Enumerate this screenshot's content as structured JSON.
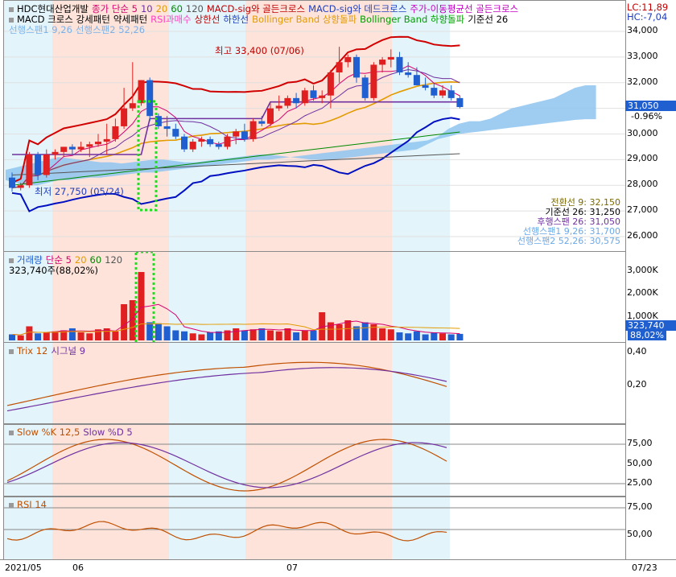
{
  "price_legend_line1": [
    {
      "text": "HDC현대산업개발",
      "color": "#000000"
    },
    {
      "text": "종가 단순 5",
      "color": "#d6006e"
    },
    {
      "text": "10",
      "color": "#7030a0"
    },
    {
      "text": "20",
      "color": "#e39b00"
    },
    {
      "text": "60",
      "color": "#008a00"
    },
    {
      "text": "120",
      "color": "#555555"
    },
    {
      "text": "MACD-sig와 골든크로스",
      "color": "#c00000"
    },
    {
      "text": "MACD-sig와 데드크로스",
      "color": "#1f3fbf"
    },
    {
      "text": "주가-이동평균선 골든크로스",
      "color": "#c000c0"
    }
  ],
  "price_legend_line2": [
    {
      "text": "MACD 크로스 강세패턴",
      "color": "#000000"
    },
    {
      "text": "약세패턴",
      "color": "#000000"
    },
    {
      "text": "RSI과매수",
      "color": "#ff40c0"
    },
    {
      "text": "상한선",
      "color": "#c00000"
    },
    {
      "text": "하한선",
      "color": "#1f3fbf"
    },
    {
      "text": "Bollinger Band 상향돌파",
      "color": "#e39b00"
    },
    {
      "text": "Bollinger Band 하향돌파",
      "color": "#00a000"
    },
    {
      "text": "기준선 26",
      "color": "#000000"
    }
  ],
  "price_legend_line3": [
    {
      "text": "선행스팬1 9,26",
      "color": "#6aa8e8"
    },
    {
      "text": "선행스팬2 52,26",
      "color": "#6aa8e8"
    }
  ],
  "top_right": {
    "lc": "LC:11,89",
    "hc": "HC:-7,04"
  },
  "price_axis": [
    "34,000",
    "33,000",
    "32,000",
    "31,000",
    "30,000",
    "29,000",
    "28,000",
    "27,000",
    "26,000"
  ],
  "current_price": {
    "value": "31,050",
    "change": "-0.96%"
  },
  "annotations": {
    "high": "최고 33,400 (07/06)",
    "low": "최저 27,750 (05/24)"
  },
  "ichimoku_labels": [
    {
      "text": "전환선 9: 32,150",
      "color": "#7a6a00"
    },
    {
      "text": "기준선 26: 31,250",
      "color": "#000000"
    },
    {
      "text": "후행스팬 26: 31,050",
      "color": "#7030a0"
    },
    {
      "text": "선행스팬1 9,26: 31,700",
      "color": "#6aa8e8"
    },
    {
      "text": "선행스팬2 52,26: 30,575",
      "color": "#6aa8e8"
    }
  ],
  "volume": {
    "legend": [
      {
        "text": "거래량",
        "color": "#1f5fd0"
      },
      {
        "text": "단순 5",
        "color": "#d6006e"
      },
      {
        "text": "20",
        "color": "#e39b00"
      },
      {
        "text": "60",
        "color": "#008a00"
      },
      {
        "text": "120",
        "color": "#555555"
      }
    ],
    "value_label": "323,740주(88,02%)",
    "axis": [
      "3,000K",
      "2,000K",
      "1,000K"
    ],
    "current": "323,740",
    "current_pct": "88,02%"
  },
  "trix": {
    "legend": [
      {
        "text": "Trix 12",
        "color": "#c05000"
      },
      {
        "text": "시그널 9",
        "color": "#7030a0"
      }
    ],
    "axis": [
      "0,40",
      "0,20"
    ]
  },
  "slow": {
    "legend": [
      {
        "text": "Slow %K 12,5",
        "color": "#c05000"
      },
      {
        "text": "Slow %D 5",
        "color": "#7030a0"
      }
    ],
    "axis": [
      "75,00",
      "50,00",
      "25,00"
    ]
  },
  "rsi": {
    "legend": [
      {
        "text": "RSI 14",
        "color": "#c05000"
      }
    ],
    "axis": [
      "75,00",
      "50,00"
    ]
  },
  "date_axis": {
    "labels": [
      "2021/05",
      "06",
      "07"
    ],
    "right": "07/23"
  },
  "colors": {
    "up": "#e02020",
    "down": "#1f5fd0",
    "bg_pink": "#fde3da",
    "bg_blue": "#e3f4fb",
    "cloud": "#8ec4f0"
  },
  "chart_data": {
    "type": "candlestick",
    "candles": [
      {
        "o": 28300,
        "h": 28500,
        "l": 27750,
        "c": 27900
      },
      {
        "o": 27900,
        "h": 28100,
        "l": 27800,
        "c": 28000
      },
      {
        "o": 28000,
        "h": 29300,
        "l": 27900,
        "c": 29200
      },
      {
        "o": 29200,
        "h": 29300,
        "l": 28200,
        "c": 28400
      },
      {
        "o": 28400,
        "h": 29400,
        "l": 28300,
        "c": 29200
      },
      {
        "o": 29200,
        "h": 29400,
        "l": 29000,
        "c": 29300
      },
      {
        "o": 29300,
        "h": 29500,
        "l": 29100,
        "c": 29500
      },
      {
        "o": 29500,
        "h": 29600,
        "l": 29200,
        "c": 29400
      },
      {
        "o": 29400,
        "h": 29700,
        "l": 29300,
        "c": 29500
      },
      {
        "o": 29500,
        "h": 29700,
        "l": 29100,
        "c": 29600
      },
      {
        "o": 29600,
        "h": 30000,
        "l": 29500,
        "c": 29700
      },
      {
        "o": 29700,
        "h": 30400,
        "l": 29200,
        "c": 29800
      },
      {
        "o": 29800,
        "h": 30600,
        "l": 29700,
        "c": 30300
      },
      {
        "o": 30300,
        "h": 31800,
        "l": 30200,
        "c": 31000
      },
      {
        "o": 31000,
        "h": 32800,
        "l": 30900,
        "c": 31200
      },
      {
        "o": 31200,
        "h": 32100,
        "l": 31100,
        "c": 32100
      },
      {
        "o": 32100,
        "h": 32200,
        "l": 30500,
        "c": 30700
      },
      {
        "o": 30700,
        "h": 30800,
        "l": 30200,
        "c": 30300
      },
      {
        "o": 30300,
        "h": 30700,
        "l": 29900,
        "c": 30200
      },
      {
        "o": 30200,
        "h": 30400,
        "l": 29800,
        "c": 29900
      },
      {
        "o": 29900,
        "h": 30000,
        "l": 29300,
        "c": 29400
      },
      {
        "o": 29400,
        "h": 29800,
        "l": 29300,
        "c": 29700
      },
      {
        "o": 29700,
        "h": 29900,
        "l": 29500,
        "c": 29800
      },
      {
        "o": 29800,
        "h": 29900,
        "l": 29500,
        "c": 29600
      },
      {
        "o": 29600,
        "h": 29700,
        "l": 29400,
        "c": 29500
      },
      {
        "o": 29500,
        "h": 30000,
        "l": 29400,
        "c": 29900
      },
      {
        "o": 29900,
        "h": 30200,
        "l": 29600,
        "c": 30100
      },
      {
        "o": 30100,
        "h": 30400,
        "l": 29700,
        "c": 29800
      },
      {
        "o": 29800,
        "h": 30600,
        "l": 29700,
        "c": 30500
      },
      {
        "o": 30500,
        "h": 30700,
        "l": 30300,
        "c": 30400
      },
      {
        "o": 30400,
        "h": 31200,
        "l": 30300,
        "c": 31000
      },
      {
        "o": 31000,
        "h": 31500,
        "l": 30900,
        "c": 31100
      },
      {
        "o": 31100,
        "h": 31500,
        "l": 31000,
        "c": 31400
      },
      {
        "o": 31400,
        "h": 31600,
        "l": 31000,
        "c": 31200
      },
      {
        "o": 31200,
        "h": 31800,
        "l": 31100,
        "c": 31700
      },
      {
        "o": 31700,
        "h": 31900,
        "l": 31300,
        "c": 31400
      },
      {
        "o": 31400,
        "h": 31700,
        "l": 31200,
        "c": 31500
      },
      {
        "o": 31500,
        "h": 32500,
        "l": 31000,
        "c": 32400
      },
      {
        "o": 32400,
        "h": 33400,
        "l": 32000,
        "c": 32800
      },
      {
        "o": 32800,
        "h": 33100,
        "l": 32600,
        "c": 33000
      },
      {
        "o": 33000,
        "h": 33100,
        "l": 32000,
        "c": 32200
      },
      {
        "o": 32200,
        "h": 32300,
        "l": 31300,
        "c": 31400
      },
      {
        "o": 31400,
        "h": 32800,
        "l": 31300,
        "c": 32700
      },
      {
        "o": 32700,
        "h": 33000,
        "l": 32400,
        "c": 32900
      },
      {
        "o": 32900,
        "h": 33300,
        "l": 32600,
        "c": 33000
      },
      {
        "o": 33000,
        "h": 33200,
        "l": 32300,
        "c": 32400
      },
      {
        "o": 32400,
        "h": 32800,
        "l": 32200,
        "c": 32300
      },
      {
        "o": 32300,
        "h": 32600,
        "l": 31900,
        "c": 31900
      },
      {
        "o": 31900,
        "h": 32200,
        "l": 31700,
        "c": 31800
      },
      {
        "o": 31800,
        "h": 32000,
        "l": 31400,
        "c": 31500
      },
      {
        "o": 31500,
        "h": 31900,
        "l": 31400,
        "c": 31700
      },
      {
        "o": 31700,
        "h": 31900,
        "l": 31300,
        "c": 31400
      },
      {
        "o": 31400,
        "h": 31500,
        "l": 31000,
        "c": 31050
      }
    ],
    "volume_k": [
      300,
      250,
      700,
      350,
      400,
      450,
      500,
      600,
      400,
      350,
      550,
      600,
      450,
      1800,
      2000,
      3400,
      900,
      850,
      700,
      500,
      450,
      350,
      300,
      400,
      450,
      500,
      600,
      500,
      550,
      600,
      500,
      450,
      600,
      400,
      500,
      500,
      1400,
      900,
      800,
      1000,
      700,
      900,
      800,
      600,
      550,
      400,
      350,
      450,
      300,
      400,
      350,
      300,
      323.74
    ]
  }
}
